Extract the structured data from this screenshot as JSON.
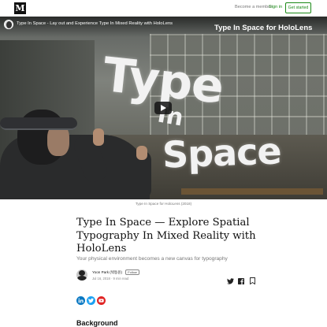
{
  "header": {
    "logo": "M",
    "become_member": "Become a member",
    "sign_in": "Sign in",
    "get_started": "Get started"
  },
  "video": {
    "youtube_title": "Type In Space - Lay out and Experience Type In Mixed Reality with HoloLens",
    "overlay_title": "Type In Space for HoloLens",
    "scene_word_1": "Type",
    "scene_word_2": "In",
    "scene_word_3": "Space",
    "caption": "Type In Space for HoloLens (2018)"
  },
  "article": {
    "title": "Type In Space — Explore Spatial Typography In Mixed Reality with HoloLens",
    "subtitle": "Your physical environment becomes a new canvas for typography",
    "author": "Yoon Park (박동윤)",
    "follow_label": "Follow",
    "meta": "Jul 16, 2018 · 9 min read",
    "section_heading": "Background"
  },
  "icons": {
    "share": [
      "twitter-icon",
      "facebook-icon",
      "bookmark-icon"
    ],
    "social": [
      "linkedin-icon",
      "twitter-icon",
      "youtube-icon"
    ]
  },
  "colors": {
    "brand_green": "#1a8917",
    "linkedin": "#0a78c2",
    "twitter": "#1da1f2",
    "youtube": "#e02424"
  }
}
